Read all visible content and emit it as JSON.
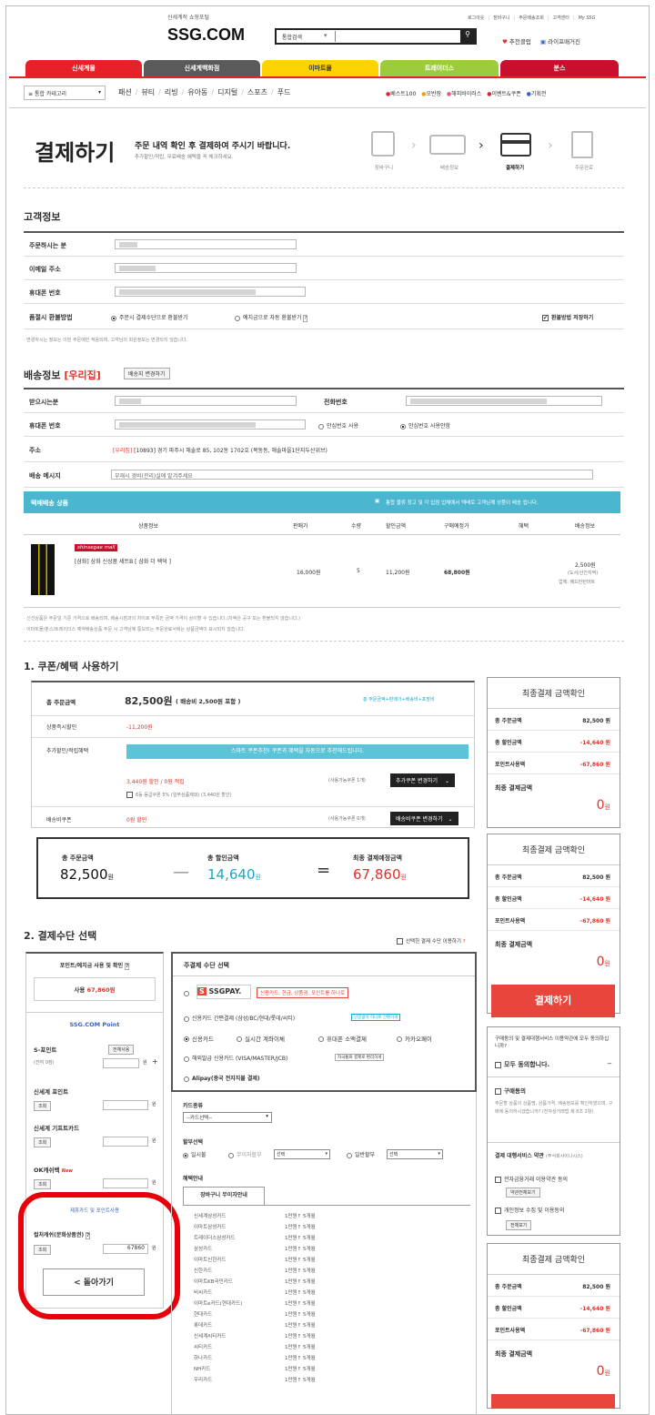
{
  "header": {
    "slogan": "신세계적 쇼핑포털",
    "logo": "SSG.COM",
    "search_scope": "통합검색",
    "search_placeholder": "",
    "util_links": [
      "로그아웃",
      "장바구니",
      "주문배송조회",
      "고객센터",
      "My SSG"
    ],
    "promo_links": [
      "추천클럽",
      "라이프매거진"
    ]
  },
  "mall_tabs": [
    {
      "label": "신세계몰",
      "color": "#e8202a"
    },
    {
      "label": "신세계백화점",
      "color": "#5a5a5a"
    },
    {
      "label": "이마트몰",
      "color": "#ffd200"
    },
    {
      "label": "트레이더스",
      "color": "#9ccc3c"
    },
    {
      "label": "분스",
      "color": "#c8102e"
    }
  ],
  "nav": {
    "category_btn": "통합 카테고리",
    "items": [
      "패션",
      "뷰티",
      "리빙",
      "유아동",
      "디지털",
      "스포츠",
      "푸드"
    ],
    "links": [
      {
        "label": "베스트100",
        "color": "#e8202a"
      },
      {
        "label": "오반장",
        "color": "#f2a200"
      },
      {
        "label": "해피바이러스",
        "color": "#e85a8a"
      },
      {
        "label": "이벤트&쿠폰",
        "color": "#e8202a"
      },
      {
        "label": "기획전",
        "color": "#3a64c8"
      }
    ]
  },
  "title": {
    "main": "결제하기",
    "sub": "주문 내역 확인 후 결제하여 주시기 바랍니다.",
    "note": "추가할인/적립, 무료배송 혜택을 꼭 체크하세요.",
    "steps": [
      "장바구니",
      "배송정보",
      "결제하기",
      "주문완료"
    ],
    "active_step": 2
  },
  "customer": {
    "heading": "고객정보",
    "orderer_label": "주문하시는 분",
    "email_label": "이메일 주소",
    "phone_label": "휴대폰 번호",
    "refund_label": "품절시 환불방법",
    "refund_opt1": "주문시 결제수단으로 환불받기",
    "refund_opt2": "예치금으로 자동 환불받기",
    "refund_save": "환불방법 저장하기",
    "note": "· 변경하시는 정보는 이번 주문에만 적용되며, 고객님의 회원정보는 변경되지 않습니다."
  },
  "shipping": {
    "heading": "배송정보",
    "tag": "[우리집]",
    "change_btn": "배송지 변경하기",
    "recipient_label": "받으시는분",
    "tel_label": "전화번호",
    "mobile_label": "휴대폰 번호",
    "safe_opt1": "안심번호 사용",
    "safe_opt2": "안심번호 사용안함",
    "addr_label": "주소",
    "addr_tag": "[우리집]",
    "addr": "[10893] 경기 파주시 해솔로 85, 102동 1702호 (목동동, 해솔마을1단지두산위브)",
    "msg_label": "배송 메시지",
    "msg_value": "부재시 경비(관리)실에 맡겨주세요"
  },
  "products": {
    "bar_title": "택배배송 상품",
    "bar_note": "통합 물류 창고 및 각 입점 업체에서 택배로 고객님께 상품이 배송 됩니다.",
    "columns": [
      "상품정보",
      "판매가",
      "수량",
      "할인금액",
      "구매예정가",
      "혜택",
      "배송정보"
    ],
    "item": {
      "brand": "shinsegae mall",
      "name": "[삼화] 삼화 신상품 세트B [ 삼화 더 렉덕 ]",
      "price": "16,000원",
      "qty": "5",
      "discount": "11,200원",
      "final": "68,800원",
      "ship_fee": "2,500원",
      "ship_note": "(도서/산간지역)",
      "ship_vendor": "업체: 배드민턴마트"
    },
    "notes": [
      "· 신선상품은 주문일 기준 가격으로 배송되며, 배송시점과의 차이로 부족한 금액 가격이 상이할 수 있습니다.(차액은 공구 또는 환불되지 않습니다.)",
      "· 이마트몰/분스/트레이더스 예약배송상품 주문 시 고객님께 통보되는 주문완료서에는 상품금액이 표시되지 않습니다."
    ]
  },
  "coupon": {
    "heading": "1. 쿠폰/혜택 사용하기",
    "total_label": "총 주문금액",
    "total_value": "82,500원",
    "total_note": "( 배송비 2,500원 포함 )",
    "formula": "총 주문금액+판매가+배송비+포장비",
    "instant_label": "상품즉시할인",
    "instant_value": "-11,200원",
    "extra_label": "추가할인/적립혜택",
    "smart_bar": "스마트 쿠폰추천! 쿠폰과 혜택을 자동으로 추천해드립니다.",
    "discount_line": "3,440원 할인 / 0원 적립",
    "avail1": "(사용가능쿠폰 1개)",
    "btn1": "추가쿠폰 변경하기",
    "grade_line": "6등 등급쿠폰 5% (일부상품제외) (3,440원 할인)",
    "shipcoupon_label": "배송비쿠폰",
    "shipcoupon_value": "0원 할인",
    "avail2": "(사용가능쿠폰 0개)",
    "btn2": "배송비쿠폰 변경하기",
    "sum_total_label": "총 주문금액",
    "sum_total": "82,500",
    "sum_disc_label": "총 할인금액",
    "sum_disc": "14,640",
    "sum_final_label": "최종 결제예정금액",
    "sum_final": "67,860",
    "won": "원"
  },
  "payment": {
    "heading": "2. 결제수단 선택",
    "show_selected": "선택한 결제 수단 이용하기",
    "points_title": "포인트/예치금 사용 및 확인",
    "points_use": "사용",
    "points_use_value": "67,860원",
    "ssg_point": "SSG.COM Point",
    "spoint_label": "S-포인트",
    "spoint_sub": "(잔여 0점)",
    "btn_all": "전체사용",
    "sp_label": "신세계 포인트",
    "gift_label": "신세계 기프트카드",
    "ok_label": "OK캐쉬백",
    "new_badge": "New",
    "btn_query": "조회",
    "won": "원",
    "red_label": "제휴카드 및 포인트사용",
    "culture_label": "컬처캐쉬(문화상품권)",
    "culture_value": "67860",
    "back_btn": "< 돌아가기",
    "method_title": "주결제 수단 선택",
    "ssgpay_promo": "신용카드, 현금, 상품권, 포인트를 하나로",
    "simple_pay": "신용카드 간편결제 (삼성/BC/현대/롯데/씨티)",
    "simple_tag": "인증없이 하나로 간편하게",
    "methods": [
      "신용카드",
      "실시간 계좌이체",
      "휴대폰 소액결제",
      "카카오페이"
    ],
    "overseas": "해외발급 신용카드 (VISA/MASTER/JCB)",
    "overseas_tag": "자국통화 결제로 편리하게",
    "alipay": "Alipay(중국 전자지불 결제)",
    "card_type_label": "카드종류",
    "card_select": "--카드선택--",
    "installment_label": "할부선택",
    "inst1": "일시불",
    "inst2": "무이자할부",
    "inst3": "일반할부",
    "sel": "선택",
    "benefit_label": "혜택안내",
    "tab": "장바구니 무이자안내",
    "cards": [
      [
        "신세계삼성카드",
        "1만원↑ 5개월"
      ],
      [
        "이마트삼성카드",
        "1만원↑ 5개월"
      ],
      [
        "트레이더스삼성카드",
        "1만원↑ 5개월"
      ],
      [
        "삼성카드",
        "1만원↑ 5개월"
      ],
      [
        "이마트신한카드",
        "1만원↑ 5개월"
      ],
      [
        "신한카드",
        "1만원↑ 5개월"
      ],
      [
        "이마트KB국민카드",
        "1만원↑ 5개월"
      ],
      [
        "비씨카드",
        "1만원↑ 5개월"
      ],
      [
        "이마트e카드(현대카드)",
        "1만원↑ 5개월"
      ],
      [
        "현대카드",
        "1만원↑ 5개월"
      ],
      [
        "롯데카드",
        "1만원↑ 5개월"
      ],
      [
        "신세계씨티카드",
        "1만원↑ 5개월"
      ],
      [
        "씨티카드",
        "1만원↑ 5개월"
      ],
      [
        "하나카드",
        "1만원↑ 5개월"
      ],
      [
        "NH카드",
        "1만원↑ 5개월"
      ],
      [
        "우리카드",
        "1만원↑ 5개월"
      ]
    ]
  },
  "summary": {
    "title": "최종결제 금액확인",
    "total_label": "총 주문금액",
    "total": "82,500",
    "disc_label": "총 할인금액",
    "disc": "-14,640",
    "point_label": "포인트사용액",
    "point": "-67,860",
    "final_label": "최종 결제금액",
    "final": "0",
    "won": "원",
    "pay_btn": "결제하기"
  },
  "agree": {
    "intro": "구매동의 및 결제대행서비스 이용약관에 모두 동의하십니까?",
    "all": "모두 동의합니다.",
    "buy": "구매동의",
    "buy_text": "주문할 상품의 상품명, 상품가격, 배송정보를 확인하였으며, 구매에 동의하시겠습니까? (전자상거래법 제 8조 2항)",
    "pg_title": "결제 대행서비스 약관",
    "pg_sub": "(주식회사이니시스)",
    "fin": "전자금융거래 이용약관 동의",
    "fin_btn": "약관전체보기",
    "priv": "개인정보 수집 및 이용동의",
    "priv_btn": "전체보기"
  }
}
